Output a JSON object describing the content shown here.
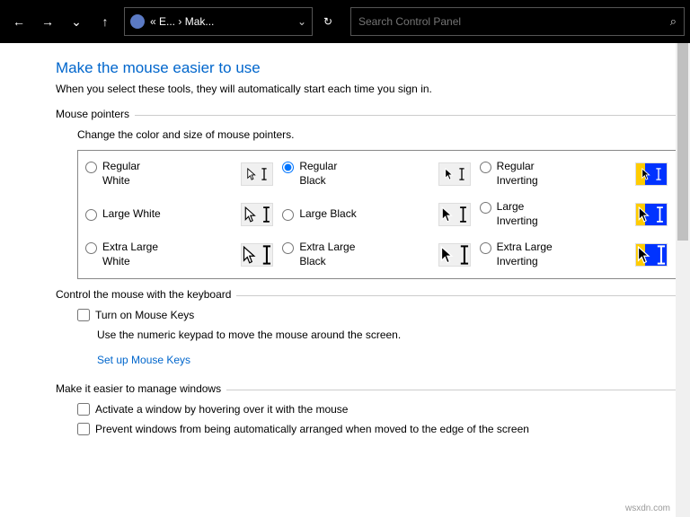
{
  "nav": {
    "back_icon": "←",
    "forward_icon": "→",
    "recent_icon": "⌄",
    "up_icon": "↑",
    "breadcrumb1": "« E...",
    "breadcrumb_sep": "›",
    "breadcrumb2": "Mak...",
    "dropdown_icon": "⌄",
    "refresh_icon": "↻",
    "search_placeholder": "Search Control Panel",
    "search_icon": "⌕"
  },
  "page": {
    "title": "Make the mouse easier to use",
    "subtitle": "When you select these tools, they will automatically start each time you sign in."
  },
  "group1": {
    "label": "Mouse pointers",
    "desc": "Change the color and size of mouse pointers.",
    "options": [
      {
        "label": "Regular White",
        "checked": false,
        "scheme": "white",
        "size": "s"
      },
      {
        "label": "Regular Black",
        "checked": true,
        "scheme": "black",
        "size": "s"
      },
      {
        "label": "Regular Inverting",
        "checked": false,
        "scheme": "inv",
        "size": "s"
      },
      {
        "label": "Large White",
        "checked": false,
        "scheme": "white",
        "size": "m"
      },
      {
        "label": "Large Black",
        "checked": false,
        "scheme": "black",
        "size": "m"
      },
      {
        "label": "Large Inverting",
        "checked": false,
        "scheme": "inv",
        "size": "m"
      },
      {
        "label": "Extra Large White",
        "checked": false,
        "scheme": "white",
        "size": "l"
      },
      {
        "label": "Extra Large Black",
        "checked": false,
        "scheme": "black",
        "size": "l"
      },
      {
        "label": "Extra Large Inverting",
        "checked": false,
        "scheme": "inv",
        "size": "l"
      }
    ]
  },
  "group2": {
    "label": "Control the mouse with the keyboard",
    "checkbox": "Turn on Mouse Keys",
    "desc": "Use the numeric keypad to move the mouse around the screen.",
    "link": "Set up Mouse Keys"
  },
  "group3": {
    "label": "Make it easier to manage windows",
    "checkbox1": "Activate a window by hovering over it with the mouse",
    "checkbox2": "Prevent windows from being automatically arranged when moved to the edge of the screen"
  },
  "watermark": "wsxdn.com"
}
